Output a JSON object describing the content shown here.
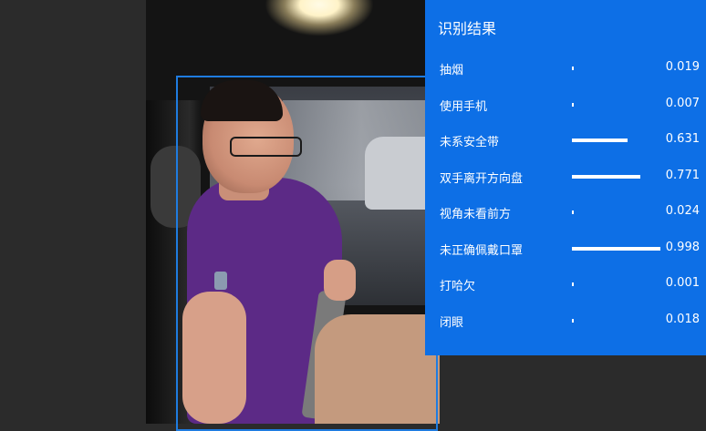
{
  "panel": {
    "title": "识别结果",
    "items": [
      {
        "label": "抽烟",
        "value": "0.019",
        "score": 0.019
      },
      {
        "label": "使用手机",
        "value": "0.007",
        "score": 0.007
      },
      {
        "label": "未系安全带",
        "value": "0.631",
        "score": 0.631
      },
      {
        "label": "双手离开方向盘",
        "value": "0.771",
        "score": 0.771
      },
      {
        "label": "视角未看前方",
        "value": "0.024",
        "score": 0.024
      },
      {
        "label": "未正确佩戴口罩",
        "value": "0.998",
        "score": 0.998
      },
      {
        "label": "打哈欠",
        "value": "0.001",
        "score": 0.001
      },
      {
        "label": "闭眼",
        "value": "0.018",
        "score": 0.018
      }
    ]
  },
  "colors": {
    "panel_bg": "#0d6fe6",
    "detection_box": "#1f7ce0",
    "page_bg": "#2b2b2b"
  }
}
